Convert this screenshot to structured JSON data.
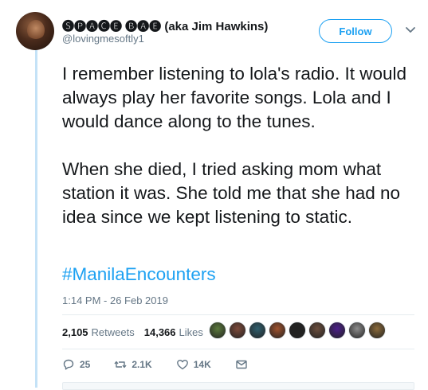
{
  "author": {
    "display_name": "🅢🅟🅐🅒🅔 🅑🅐🅔 (aka Jim Hawkins)",
    "handle": "@lovingmesoftly1",
    "follow_label": "Follow"
  },
  "tweet": {
    "paragraphs": [
      "I remember listening to lola's radio. It would always play her favorite songs. Lola and I would dance along to the tunes.",
      "When she died, I tried asking mom what station it was. She told me that she had no idea since we kept listening to static."
    ],
    "hashtag": "#ManilaEncounters",
    "timestamp": "1:14 PM - 26 Feb 2019"
  },
  "stats": {
    "retweets_count": "2,105",
    "retweets_label": "Retweets",
    "likes_count": "14,366",
    "likes_label": "Likes"
  },
  "liker_avatars": [
    "#5b7a3c",
    "#7d4a3a",
    "#2f5f6e",
    "#a0522d",
    "#222222",
    "#6b4e3d",
    "#4b1e8a",
    "#8c8c8c",
    "#8a6a3a"
  ],
  "actions": {
    "reply_count": "25",
    "retweet_count": "2.1K",
    "like_count": "14K"
  },
  "colors": {
    "accent": "#1da1f2",
    "muted": "#657786",
    "thread_line": "#c4e2f7"
  }
}
